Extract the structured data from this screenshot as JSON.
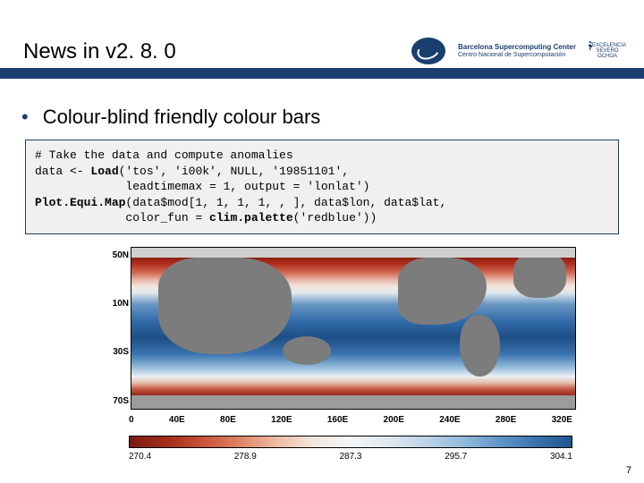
{
  "header": {
    "title": "News in v2. 8. 0",
    "logo_bsc_name": "Barcelona Supercomputing Center",
    "logo_bsc_sub": "Centro Nacional de Supercomputación",
    "logo_exc": "EXCELENCIA SEVERO OCHOA"
  },
  "bullet": {
    "text": "Colour-blind friendly colour bars"
  },
  "code": {
    "l1": "# Take the data and compute anomalies",
    "l2a": "data <- ",
    "l2b": "Load",
    "l2c": "('tos', 'i00k', NULL, '19851101',",
    "l3": "             leadtimemax = 1, output = 'lonlat')",
    "l4a": "Plot.Equi.Map",
    "l4b": "(data$mod[1, 1, 1, 1, , ], data$lon, data$lat,",
    "l5a": "             color_fun = ",
    "l5b": "clim.palette",
    "l5c": "('redblue'))"
  },
  "chart_data": {
    "type": "heatmap",
    "title": "",
    "xlabel": "",
    "ylabel": "",
    "x_ticks": [
      "0",
      "40E",
      "80E",
      "120E",
      "160E",
      "200E",
      "240E",
      "280E",
      "320E"
    ],
    "y_ticks": [
      "50N",
      "10N",
      "30S",
      "70S"
    ],
    "xlim": [
      0,
      360
    ],
    "ylim": [
      -90,
      90
    ],
    "grid": false,
    "colorbar": {
      "palette": "redblue",
      "ticks": [
        270.4,
        278.9,
        287.3,
        295.7,
        304.1
      ],
      "label": ""
    }
  },
  "page_number": "7"
}
